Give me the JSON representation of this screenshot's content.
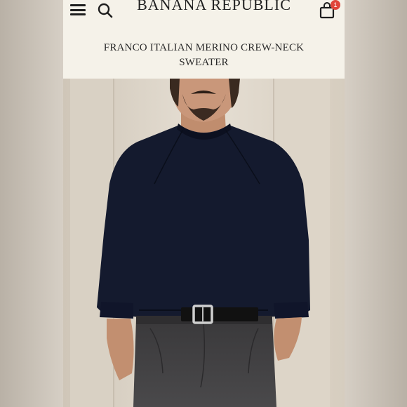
{
  "header": {
    "brand": "BANANA REPUBLIC",
    "menu_icon": "hamburger-menu-icon",
    "search_icon": "search-icon",
    "bag_icon": "shopping-bag-icon",
    "bag_count": "1",
    "badge_color": "#e0453a"
  },
  "product": {
    "title_line1": "FRANCO ITALIAN MERINO CREW-NECK",
    "title_line2": "SWEATER",
    "image": "model-wearing-navy-crew-neck-sweater"
  },
  "colors": {
    "header_bg": "#f5f2e9",
    "sweater": "#141a2e",
    "pants": "#3f3e40"
  }
}
